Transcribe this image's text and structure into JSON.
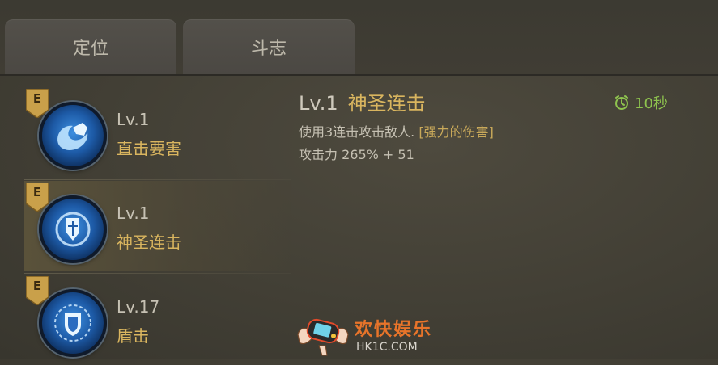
{
  "tabs": [
    {
      "label": "定位"
    },
    {
      "label": "斗志"
    }
  ],
  "skills": [
    {
      "grade": "E",
      "level": "Lv.1",
      "name": "直击要害",
      "icon": "fist-swirl-icon"
    },
    {
      "grade": "E",
      "level": "Lv.1",
      "name": "神圣连击",
      "icon": "holy-cross-shield-icon"
    },
    {
      "grade": "E",
      "level": "Lv.17",
      "name": "盾击",
      "icon": "shield-sun-icon"
    }
  ],
  "detail": {
    "level": "Lv.1",
    "name": "神圣连击",
    "cooldown": "10秒",
    "description": "使用3连击攻击敌人. ",
    "description_tag": "[强力的伤害]",
    "damage": "攻击力 265% + 51"
  },
  "watermark": {
    "title": "欢快娱乐",
    "site": "HK1C.COM"
  },
  "colors": {
    "gold_text": "#d9b55f",
    "cooldown_green": "#8ec34e",
    "grade_badge": "#c9a04a"
  }
}
